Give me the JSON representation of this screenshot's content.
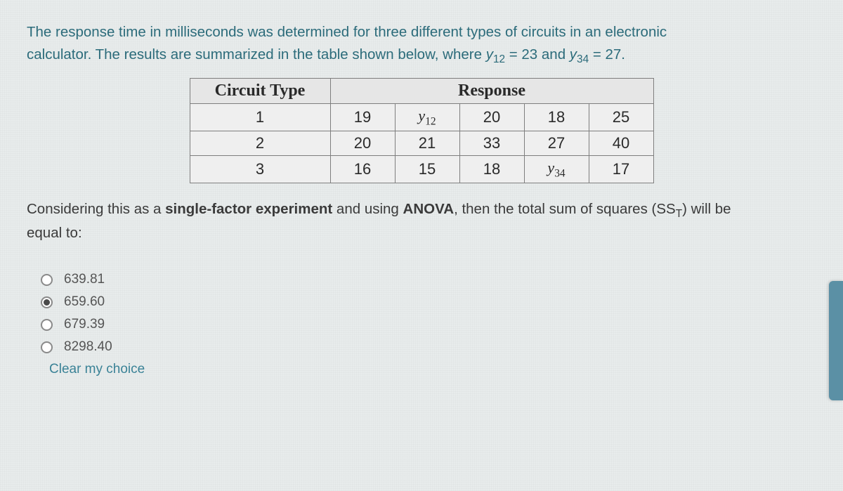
{
  "intro": {
    "p1_a": "The response time in milliseconds was determined for three different types of circuits in an electronic",
    "p2_a": "calculator. The results are summarized in the table shown below, where ",
    "var1": "y",
    "sub1": "12",
    "eq1": " = 23 and ",
    "var2": "y",
    "sub2": "34",
    "eq2": " = 27."
  },
  "table": {
    "headers": {
      "type": "Circuit Type",
      "resp": "Response"
    },
    "rows": [
      {
        "type": "1",
        "c1": "19",
        "c2_sym": true,
        "c2_v": "y",
        "c2_s": "12",
        "c3": "20",
        "c4": "18",
        "c5": "25"
      },
      {
        "type": "2",
        "c1": "20",
        "c2_sym": false,
        "c2": "21",
        "c3": "33",
        "c4": "27",
        "c5": "40"
      },
      {
        "type": "3",
        "c1": "16",
        "c2_sym": false,
        "c2": "15",
        "c3": "18",
        "c4_sym": true,
        "c4_v": "y",
        "c4_s": "34",
        "c5": "17"
      }
    ]
  },
  "question": {
    "a": "Considering this as a ",
    "b": "single-factor experiment",
    "c": " and using ",
    "d": "ANOVA",
    "e": ", then the total sum of squares (SS",
    "sub": "T",
    "f": ") will be",
    "g": "equal to:"
  },
  "options": [
    {
      "label": "639.81",
      "selected": false
    },
    {
      "label": "659.60",
      "selected": true
    },
    {
      "label": "679.39",
      "selected": false
    },
    {
      "label": "8298.40",
      "selected": false
    }
  ],
  "clear": "Clear my choice"
}
